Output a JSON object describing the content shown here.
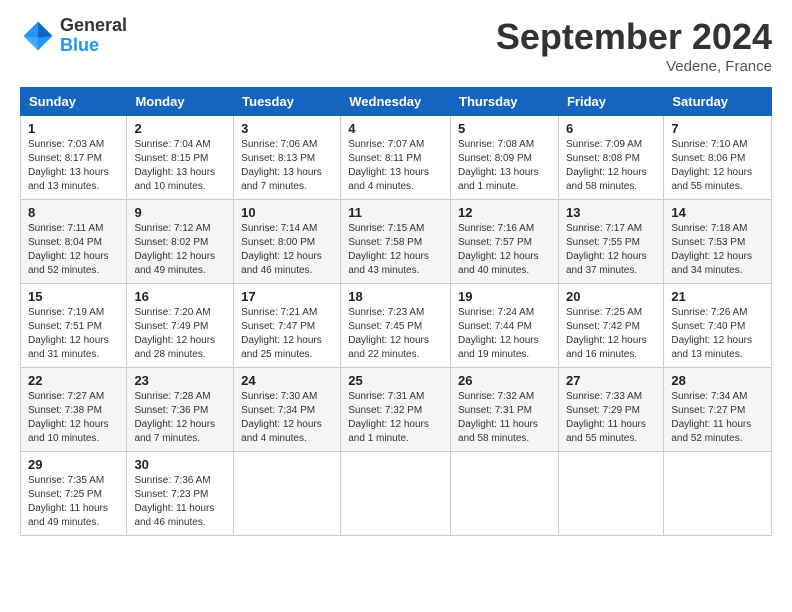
{
  "header": {
    "logo_general": "General",
    "logo_blue": "Blue",
    "month_title": "September 2024",
    "subtitle": "Vedene, France"
  },
  "days_of_week": [
    "Sunday",
    "Monday",
    "Tuesday",
    "Wednesday",
    "Thursday",
    "Friday",
    "Saturday"
  ],
  "weeks": [
    [
      {
        "day": "1",
        "info": "Sunrise: 7:03 AM\nSunset: 8:17 PM\nDaylight: 13 hours\nand 13 minutes."
      },
      {
        "day": "2",
        "info": "Sunrise: 7:04 AM\nSunset: 8:15 PM\nDaylight: 13 hours\nand 10 minutes."
      },
      {
        "day": "3",
        "info": "Sunrise: 7:06 AM\nSunset: 8:13 PM\nDaylight: 13 hours\nand 7 minutes."
      },
      {
        "day": "4",
        "info": "Sunrise: 7:07 AM\nSunset: 8:11 PM\nDaylight: 13 hours\nand 4 minutes."
      },
      {
        "day": "5",
        "info": "Sunrise: 7:08 AM\nSunset: 8:09 PM\nDaylight: 13 hours\nand 1 minute."
      },
      {
        "day": "6",
        "info": "Sunrise: 7:09 AM\nSunset: 8:08 PM\nDaylight: 12 hours\nand 58 minutes."
      },
      {
        "day": "7",
        "info": "Sunrise: 7:10 AM\nSunset: 8:06 PM\nDaylight: 12 hours\nand 55 minutes."
      }
    ],
    [
      {
        "day": "8",
        "info": "Sunrise: 7:11 AM\nSunset: 8:04 PM\nDaylight: 12 hours\nand 52 minutes."
      },
      {
        "day": "9",
        "info": "Sunrise: 7:12 AM\nSunset: 8:02 PM\nDaylight: 12 hours\nand 49 minutes."
      },
      {
        "day": "10",
        "info": "Sunrise: 7:14 AM\nSunset: 8:00 PM\nDaylight: 12 hours\nand 46 minutes."
      },
      {
        "day": "11",
        "info": "Sunrise: 7:15 AM\nSunset: 7:58 PM\nDaylight: 12 hours\nand 43 minutes."
      },
      {
        "day": "12",
        "info": "Sunrise: 7:16 AM\nSunset: 7:57 PM\nDaylight: 12 hours\nand 40 minutes."
      },
      {
        "day": "13",
        "info": "Sunrise: 7:17 AM\nSunset: 7:55 PM\nDaylight: 12 hours\nand 37 minutes."
      },
      {
        "day": "14",
        "info": "Sunrise: 7:18 AM\nSunset: 7:53 PM\nDaylight: 12 hours\nand 34 minutes."
      }
    ],
    [
      {
        "day": "15",
        "info": "Sunrise: 7:19 AM\nSunset: 7:51 PM\nDaylight: 12 hours\nand 31 minutes."
      },
      {
        "day": "16",
        "info": "Sunrise: 7:20 AM\nSunset: 7:49 PM\nDaylight: 12 hours\nand 28 minutes."
      },
      {
        "day": "17",
        "info": "Sunrise: 7:21 AM\nSunset: 7:47 PM\nDaylight: 12 hours\nand 25 minutes."
      },
      {
        "day": "18",
        "info": "Sunrise: 7:23 AM\nSunset: 7:45 PM\nDaylight: 12 hours\nand 22 minutes."
      },
      {
        "day": "19",
        "info": "Sunrise: 7:24 AM\nSunset: 7:44 PM\nDaylight: 12 hours\nand 19 minutes."
      },
      {
        "day": "20",
        "info": "Sunrise: 7:25 AM\nSunset: 7:42 PM\nDaylight: 12 hours\nand 16 minutes."
      },
      {
        "day": "21",
        "info": "Sunrise: 7:26 AM\nSunset: 7:40 PM\nDaylight: 12 hours\nand 13 minutes."
      }
    ],
    [
      {
        "day": "22",
        "info": "Sunrise: 7:27 AM\nSunset: 7:38 PM\nDaylight: 12 hours\nand 10 minutes."
      },
      {
        "day": "23",
        "info": "Sunrise: 7:28 AM\nSunset: 7:36 PM\nDaylight: 12 hours\nand 7 minutes."
      },
      {
        "day": "24",
        "info": "Sunrise: 7:30 AM\nSunset: 7:34 PM\nDaylight: 12 hours\nand 4 minutes."
      },
      {
        "day": "25",
        "info": "Sunrise: 7:31 AM\nSunset: 7:32 PM\nDaylight: 12 hours\nand 1 minute."
      },
      {
        "day": "26",
        "info": "Sunrise: 7:32 AM\nSunset: 7:31 PM\nDaylight: 11 hours\nand 58 minutes."
      },
      {
        "day": "27",
        "info": "Sunrise: 7:33 AM\nSunset: 7:29 PM\nDaylight: 11 hours\nand 55 minutes."
      },
      {
        "day": "28",
        "info": "Sunrise: 7:34 AM\nSunset: 7:27 PM\nDaylight: 11 hours\nand 52 minutes."
      }
    ],
    [
      {
        "day": "29",
        "info": "Sunrise: 7:35 AM\nSunset: 7:25 PM\nDaylight: 11 hours\nand 49 minutes."
      },
      {
        "day": "30",
        "info": "Sunrise: 7:36 AM\nSunset: 7:23 PM\nDaylight: 11 hours\nand 46 minutes."
      },
      {
        "day": "",
        "info": ""
      },
      {
        "day": "",
        "info": ""
      },
      {
        "day": "",
        "info": ""
      },
      {
        "day": "",
        "info": ""
      },
      {
        "day": "",
        "info": ""
      }
    ]
  ]
}
